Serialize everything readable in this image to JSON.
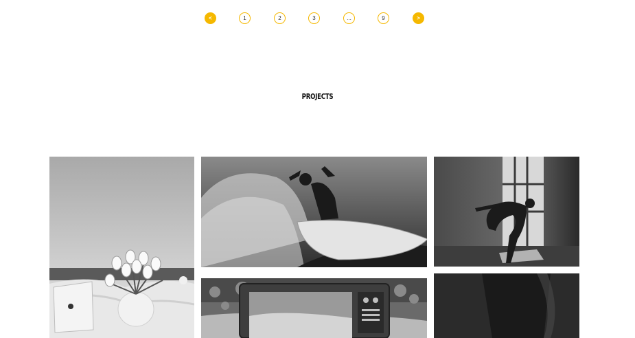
{
  "theme": {
    "accent": "#f5b800"
  },
  "pagination": {
    "prev_label": "<",
    "pages": [
      "1",
      "2",
      "3",
      "...",
      "9"
    ],
    "next_label": ">"
  },
  "section": {
    "title": "PROJECTS"
  },
  "gallery": {
    "items": [
      {
        "subject": "tulips-laptop-photo"
      },
      {
        "subject": "surfer-wave-photo"
      },
      {
        "subject": "dancer-window-photo"
      },
      {
        "subject": "retro-tv-river-photo"
      },
      {
        "subject": "dark-fabric-photo"
      }
    ]
  }
}
